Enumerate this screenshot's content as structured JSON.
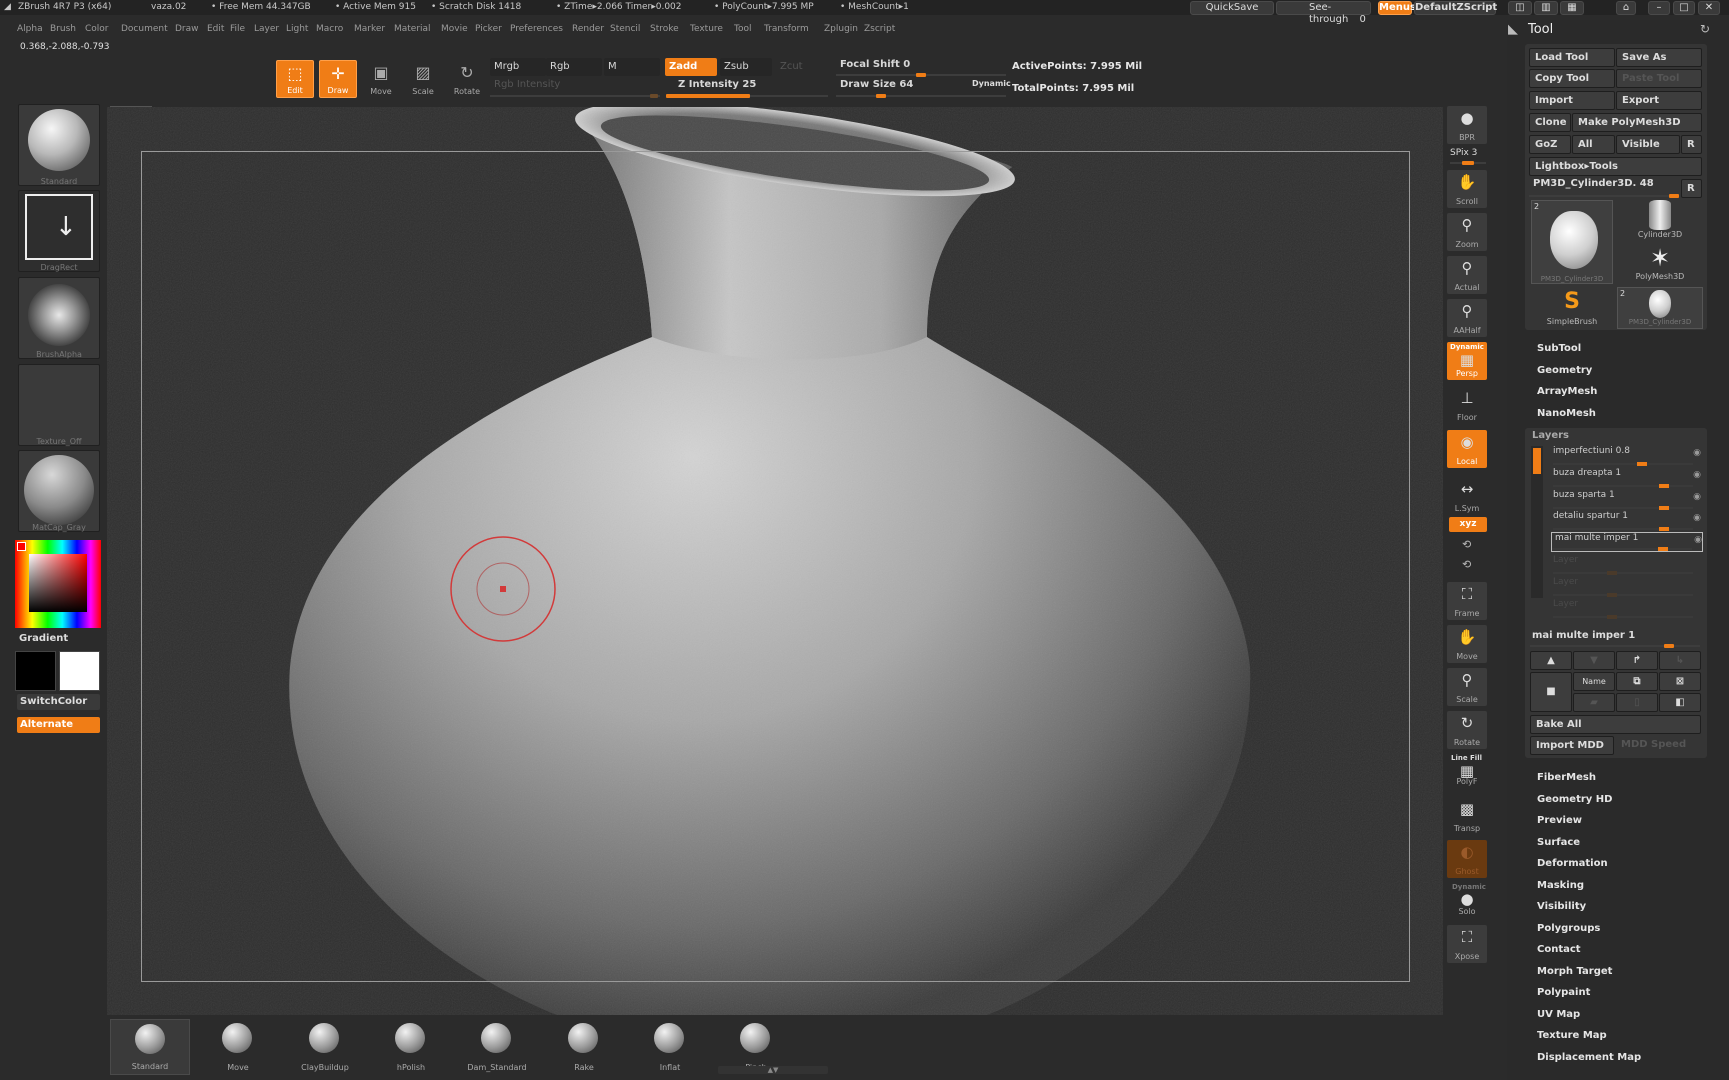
{
  "titlebar": {
    "app": "ZBrush 4R7 P3 (x64)",
    "doc": "vaza.02",
    "free_mem": "• Free Mem 44.347GB",
    "active_mem": "• Active Mem 915",
    "scratch": "• Scratch Disk 1418",
    "ztime": "• ZTime▸2.066 Timer▸0.002",
    "polycount": "• PolyCount▸7.995 MP",
    "meshcount": "• MeshCount▸1",
    "quicksave": "QuickSave",
    "seethrough": "See-through",
    "seethrough_val": "0",
    "menus": "Menus",
    "script": "DefaultZScript"
  },
  "menubar": [
    "Alpha",
    "Brush",
    "Color",
    "Document",
    "Draw",
    "Edit",
    "File",
    "Layer",
    "Light",
    "Macro",
    "Marker",
    "Material",
    "Movie",
    "Picker",
    "Preferences",
    "Render",
    "Stencil",
    "Stroke",
    "Texture",
    "Tool",
    "Transform",
    "Zplugin",
    "Zscript"
  ],
  "coords": "0.368,-2.088,-0.793",
  "topshelf": {
    "edit": "Edit",
    "draw": "Draw",
    "move": "Move",
    "scale": "Scale",
    "rotate": "Rotate",
    "mrgb": "Mrgb",
    "rgb": "Rgb",
    "m": "M",
    "rgb_intensity": "Rgb Intensity",
    "zadd": "Zadd",
    "zsub": "Zsub",
    "zcut": "Zcut",
    "z_intensity": "Z Intensity 25",
    "focal_shift": "Focal Shift 0",
    "draw_size": "Draw Size 64",
    "dynamic": "Dynamic",
    "active_points": "ActivePoints: 7.995 Mil",
    "total_points": "TotalPoints: 7.995 Mil",
    "z_intensity_value": 25,
    "draw_size_value": 64,
    "focal_shift_value": 0
  },
  "leftshelf": {
    "standard": "Standard",
    "dragrect": "DragRect",
    "brushalpha": "BrushAlpha",
    "texture_off": "Texture_Off",
    "matcap": "MatCap_Gray",
    "gradient": "Gradient",
    "switchcolor": "SwitchColor",
    "alternate": "Alternate"
  },
  "rightshelf": {
    "bpr": "BPR",
    "spix": "SPix 3",
    "scroll": "Scroll",
    "zoom": "Zoom",
    "actual": "Actual",
    "aahalf": "AAHalf",
    "dynamic": "Dynamic",
    "persp": "Persp",
    "floor": "Floor",
    "local": "Local",
    "lsym": "L.Sym",
    "xyz": "xyz",
    "frame": "Frame",
    "move": "Move",
    "scale": "Scale",
    "rotate": "Rotate",
    "linefill": "Line Fill",
    "polyf": "PolyF",
    "transp": "Transp",
    "ghost": "Ghost",
    "dynamic2": "Dynamic",
    "solo": "Solo",
    "xpose": "Xpose"
  },
  "tool": {
    "title": "Tool",
    "load_tool": "Load Tool",
    "save_as": "Save As",
    "copy_tool": "Copy Tool",
    "paste_tool": "Paste Tool",
    "import": "Import",
    "export": "Export",
    "clone": "Clone",
    "make_polymesh": "Make PolyMesh3D",
    "goz": "GoZ",
    "all": "All",
    "visible": "Visible",
    "r": "R",
    "lightbox_tools": "Lightbox▸Tools",
    "current_tool": "PM3D_Cylinder3D. 48",
    "thumbs": [
      {
        "label": "PM3D_Cylinder3D",
        "badge": "2"
      },
      {
        "label": "Cylinder3D",
        "badge": ""
      },
      {
        "label": "PolyMesh3D",
        "badge": ""
      },
      {
        "label": "SimpleBrush",
        "badge": ""
      },
      {
        "label": "PM3D_Cylinder3D",
        "badge": "2"
      }
    ],
    "sections_top": [
      "SubTool",
      "Geometry",
      "ArrayMesh",
      "NanoMesh"
    ],
    "layers_title": "Layers",
    "layers": [
      {
        "name": "imperfectiuni 0.8",
        "value": 0.8
      },
      {
        "name": "buza dreapta 1",
        "value": 1
      },
      {
        "name": "buza sparta 1",
        "value": 1
      },
      {
        "name": "detaliu spartur 1",
        "value": 1
      },
      {
        "name": "mai multe imper 1",
        "value": 1
      }
    ],
    "empty_layers": [
      "Layer",
      "Layer",
      "Layer"
    ],
    "selected_layer": "mai multe imper 1",
    "name_btn": "Name",
    "bake_all": "Bake All",
    "import_mdd": "Import MDD",
    "mdd_speed": "MDD Speed",
    "sections_bottom": [
      "FiberMesh",
      "Geometry HD",
      "Preview",
      "Surface",
      "Deformation",
      "Masking",
      "Visibility",
      "Polygroups",
      "Contact",
      "Morph Target",
      "Polypaint",
      "UV Map",
      "Texture Map",
      "Displacement Map"
    ]
  },
  "brushes": [
    "Standard",
    "Move",
    "ClayBuildup",
    "hPolish",
    "Dam_Standard",
    "Rake",
    "Inflat",
    "Pinch"
  ],
  "colors": {
    "accent": "#f07d16",
    "panel": "#3d3d3d",
    "bg": "#2b2b2b"
  }
}
